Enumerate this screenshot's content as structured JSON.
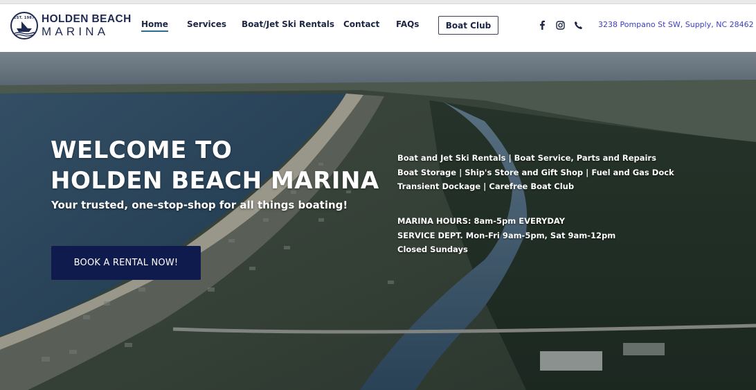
{
  "brand": {
    "est_label": "EST. 1987",
    "line1": "HOLDEN BEACH",
    "line2": "MARINA"
  },
  "nav": {
    "items": [
      {
        "label": "Home",
        "active": true
      },
      {
        "label": "Services"
      },
      {
        "label": "Boat/Jet Ski Rentals"
      },
      {
        "label": "Contact"
      },
      {
        "label": "FAQs"
      }
    ],
    "cta_label": "Boat Club"
  },
  "social": {
    "icons": [
      "facebook-icon",
      "instagram-icon",
      "phone-icon"
    ]
  },
  "address": "3238 Pompano St SW, Supply, NC 28462",
  "hero": {
    "title_line1": "WELCOME TO",
    "title_line2": "HOLDEN BEACH MARINA",
    "subtitle": "Your trusted, one-stop-shop for all things boating!",
    "button_label": "BOOK A RENTAL NOW!",
    "services": [
      "Boat and Jet Ski Rentals | Boat Service, Parts and Repairs",
      "Boat Storage | Ship's Store and Gift Shop | Fuel and Gas Dock",
      "Transient Dockage | Carefree Boat Club"
    ],
    "hours": [
      "MARINA HOURS: 8am-5pm EVERYDAY",
      "SERVICE DEPT. Mon-Fri 9am-5pm, Sat 9am-12pm",
      "Closed Sundays"
    ]
  },
  "colors": {
    "navy": "#1e2a52",
    "button_bg": "#0f1b4d",
    "address_link": "#3b3ec9",
    "active_underline": "#2c6d8c"
  }
}
